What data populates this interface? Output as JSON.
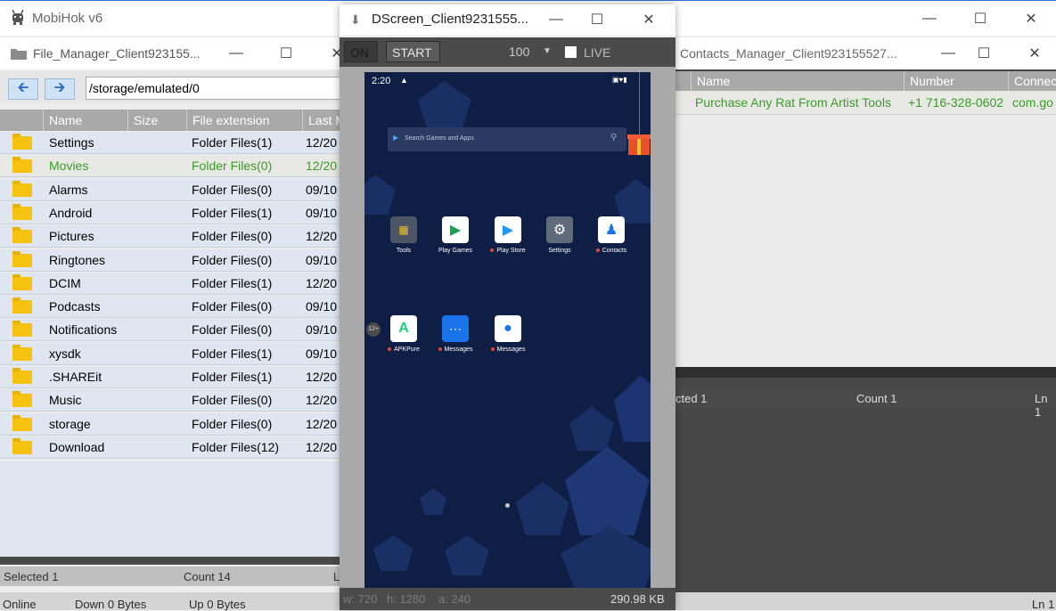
{
  "app": {
    "title": "MobiHok v6"
  },
  "status_bar": {
    "online": "Online",
    "down": "Down 0 Bytes",
    "up": "Up 0 Bytes",
    "ln": "Ln 1"
  },
  "file_manager": {
    "title": "File_Manager_Client923155...",
    "path": "/storage/emulated/0",
    "columns": [
      "Name",
      "Size",
      "File extension",
      "Last M"
    ],
    "rows": [
      {
        "name": "Settings",
        "ext": "Folder Files(1)",
        "date": "12/20"
      },
      {
        "name": "Movies",
        "ext": "Folder Files(0)",
        "date": "12/20"
      },
      {
        "name": "Alarms",
        "ext": "Folder Files(0)",
        "date": "09/10"
      },
      {
        "name": "Android",
        "ext": "Folder Files(1)",
        "date": "09/10"
      },
      {
        "name": "Pictures",
        "ext": "Folder Files(0)",
        "date": "12/20"
      },
      {
        "name": "Ringtones",
        "ext": "Folder Files(0)",
        "date": "09/10"
      },
      {
        "name": "DCIM",
        "ext": "Folder Files(1)",
        "date": "12/20"
      },
      {
        "name": "Podcasts",
        "ext": "Folder Files(0)",
        "date": "09/10"
      },
      {
        "name": "Notifications",
        "ext": "Folder Files(0)",
        "date": "09/10"
      },
      {
        "name": "xysdk",
        "ext": "Folder Files(1)",
        "date": "09/10"
      },
      {
        "name": ".SHAREit",
        "ext": "Folder Files(1)",
        "date": "12/20"
      },
      {
        "name": "Music",
        "ext": "Folder Files(0)",
        "date": "12/20"
      },
      {
        "name": "storage",
        "ext": "Folder Files(0)",
        "date": "12/20"
      },
      {
        "name": "Download",
        "ext": "Folder Files(12)",
        "date": "12/20"
      }
    ],
    "footer": {
      "selected": "Selected 1",
      "count": "Count 14",
      "ln": "L"
    }
  },
  "contacts_manager": {
    "title": "Contacts_Manager_Client923155527...",
    "columns": [
      "Name",
      "Number",
      "Connec"
    ],
    "row": {
      "name": "Purchase Any Rat From Artist Tools",
      "number": "+1 716-328-0602",
      "conn": "com.go"
    },
    "footer": {
      "selected": "cted 1",
      "count": "Count 1",
      "ln": "Ln 1"
    }
  },
  "dscreen": {
    "title": "DScreen_Client9231555...",
    "on_label": "ON",
    "start_label": "START",
    "quality": "100",
    "live_label": "LIVE",
    "footer": {
      "w": "w: 720",
      "h": "h: 1280",
      "a": "a: 240",
      "size": "290.98 KB"
    }
  },
  "phone": {
    "time": "2:20",
    "search_placeholder": "Search Games and Apps",
    "badge": "12+",
    "apps_row1": [
      {
        "label": "Tools",
        "icon": "tools-icon"
      },
      {
        "label": "Play Games",
        "icon": "play-games-icon"
      },
      {
        "label": "Play Store",
        "icon": "play-store-icon"
      },
      {
        "label": "Settings",
        "icon": "settings-icon"
      },
      {
        "label": "Contacts",
        "icon": "contacts-icon"
      }
    ],
    "apps_row2": [
      {
        "label": "APKPure",
        "icon": "apkpure-icon"
      },
      {
        "label": "Messages",
        "icon": "messages-icon"
      },
      {
        "label": "Messages",
        "icon": "messages-bubble-icon"
      }
    ]
  }
}
